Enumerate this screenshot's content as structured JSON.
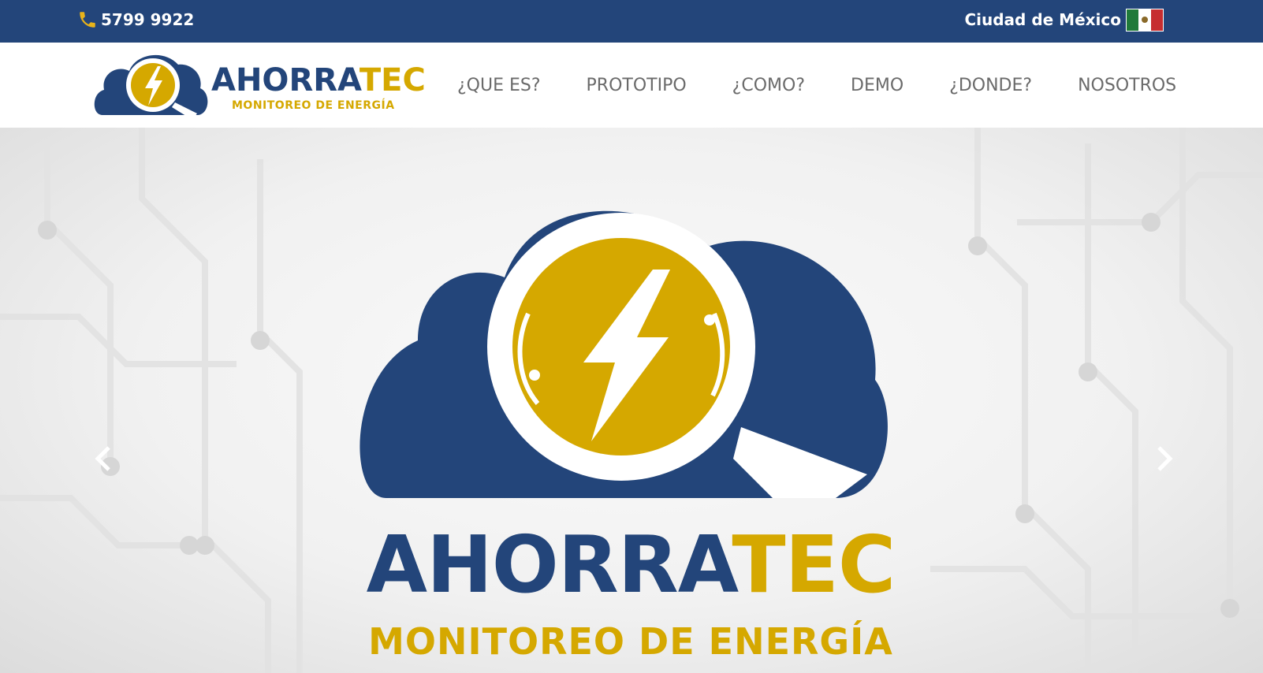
{
  "topbar": {
    "phone": "5799 9922",
    "phone_icon": "phone-icon",
    "city": "Ciudad de México",
    "flag_icon": "mexico-flag-icon"
  },
  "brand": {
    "name_part1": "AHORRA",
    "name_part2": "TEC",
    "tagline": "MONITOREO DE ENERGÍA",
    "colors": {
      "navy": "#23457a",
      "gold": "#d5a800"
    }
  },
  "nav": {
    "items": [
      {
        "label": "¿QUE ES?"
      },
      {
        "label": "PROTOTIPO"
      },
      {
        "label": "¿COMO?"
      },
      {
        "label": "DEMO"
      },
      {
        "label": "¿DONDE?"
      },
      {
        "label": "NOSOTROS"
      }
    ]
  },
  "hero": {
    "name_part1": "AHORRA",
    "name_part2": "TEC",
    "tagline": "MONITOREO DE ENERGÍA",
    "prev_icon": "chevron-left-icon",
    "next_icon": "chevron-right-icon"
  }
}
